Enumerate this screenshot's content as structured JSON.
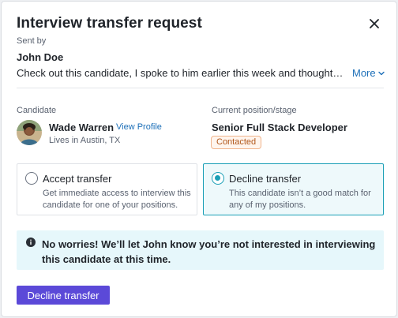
{
  "modal": {
    "title": "Interview transfer request",
    "close_icon": "close-icon"
  },
  "sender": {
    "label": "Sent by",
    "name": "John Doe",
    "message": "Check out this candidate, I spoke to him earlier this week and thought he’...",
    "more_label": "More",
    "more_icon": "chevron-down-icon"
  },
  "candidate": {
    "label": "Candidate",
    "name": "Wade Warren",
    "view_profile": "View Profile",
    "location": "Lives in Austin, TX",
    "avatar_icon": "avatar"
  },
  "position": {
    "label": "Current position/stage",
    "title": "Senior Full Stack Developer",
    "stage": "Contacted"
  },
  "options": [
    {
      "title": "Accept transfer",
      "description": "Get immediate access to interview this candidate for one of your positions.",
      "selected": false
    },
    {
      "title": "Decline transfer",
      "description": "This candidate isn’t a good match for any of my positions.",
      "selected": true
    }
  ],
  "notice": {
    "icon": "info-icon",
    "text": "No worries! We’ll let John know you’re not interested in interviewing this candidate at this time."
  },
  "actions": {
    "primary_label": "Decline transfer"
  },
  "colors": {
    "accent": "#5b49d8",
    "link": "#1c6fb8",
    "selected_border": "#1a9fb6",
    "notice_bg": "#e6f7fb",
    "badge_text": "#b0561a"
  }
}
